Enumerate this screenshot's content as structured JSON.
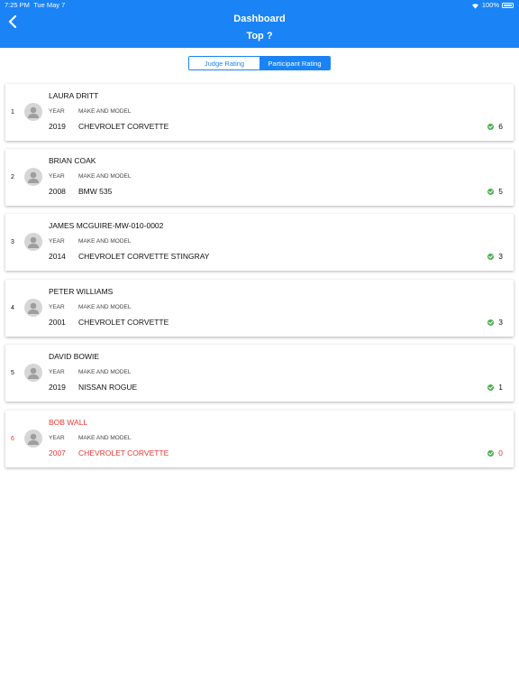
{
  "status_bar": {
    "time": "7:25 PM",
    "date": "Tue May 7",
    "battery": "100%"
  },
  "header": {
    "title": "Dashboard",
    "subtitle": "Top ?"
  },
  "segment": {
    "judge_label": "Judge Rating",
    "participant_label": "Participant Rating",
    "selected": "Participant Rating"
  },
  "labels": {
    "year": "YEAR",
    "make_model": "MAKE AND MODEL"
  },
  "colors": {
    "accent": "#1a83f5",
    "highlight": "#e53935",
    "score_dot": "#4caf50"
  },
  "entries": [
    {
      "rank": "1",
      "name": "LAURA DRITT",
      "year": "2019",
      "model": "CHEVROLET CORVETTE",
      "score": "6"
    },
    {
      "rank": "2",
      "name": "BRIAN COAK",
      "year": "2008",
      "model": "BMW 535",
      "score": "5"
    },
    {
      "rank": "3",
      "name": "JAMES MCGUIRE-MW-010-0002",
      "year": "2014",
      "model": "CHEVROLET CORVETTE STINGRAY",
      "score": "3"
    },
    {
      "rank": "4",
      "name": "PETER WILLIAMS",
      "year": "2001",
      "model": "CHEVROLET CORVETTE",
      "score": "3"
    },
    {
      "rank": "5",
      "name": "DAVID BOWIE",
      "year": "2019",
      "model": "NISSAN ROGUE",
      "score": "1"
    },
    {
      "rank": "6",
      "name": "BOB WALL",
      "year": "2007",
      "model": "CHEVROLET CORVETTE",
      "score": "0"
    }
  ]
}
